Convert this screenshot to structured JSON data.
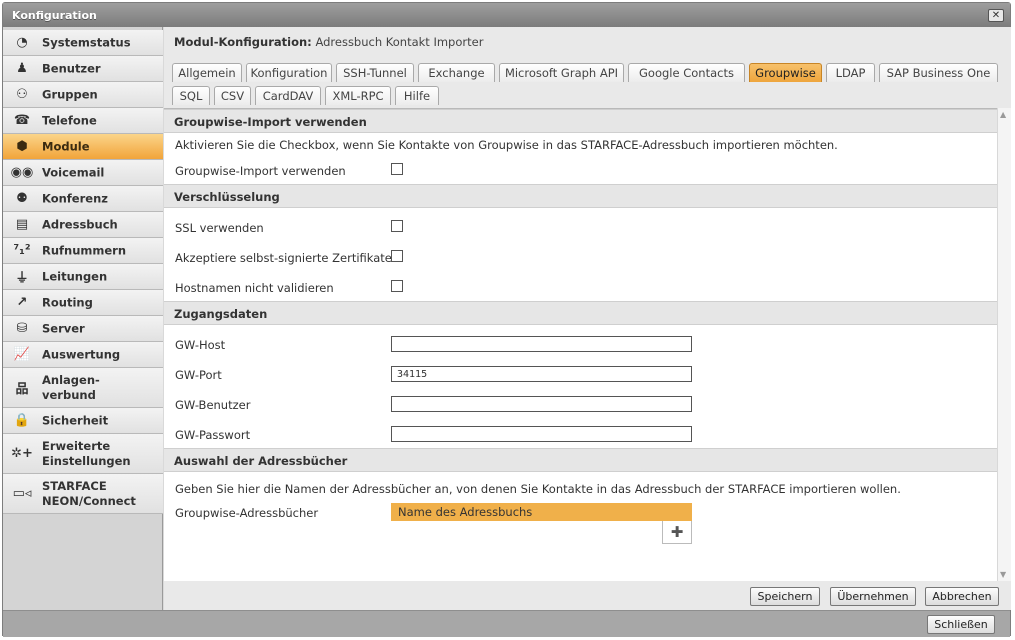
{
  "window": {
    "title": "Konfiguration",
    "close_symbol": "✕"
  },
  "sidebar": {
    "items": [
      {
        "label": "Systemstatus",
        "icon": "pie-chart-icon",
        "glyph": "◔"
      },
      {
        "label": "Benutzer",
        "icon": "user-icon",
        "glyph": "♟"
      },
      {
        "label": "Gruppen",
        "icon": "group-icon",
        "glyph": "⚇"
      },
      {
        "label": "Telefone",
        "icon": "telephone-icon",
        "glyph": "☎"
      },
      {
        "label": "Module",
        "icon": "cube-icon",
        "glyph": "⬢"
      },
      {
        "label": "Voicemail",
        "icon": "voicemail-icon",
        "glyph": "◉◉"
      },
      {
        "label": "Konferenz",
        "icon": "conference-icon",
        "glyph": "⚉"
      },
      {
        "label": "Adressbuch",
        "icon": "address-book-icon",
        "glyph": "▤"
      },
      {
        "label": "Rufnummern",
        "icon": "numbers-icon",
        "glyph": "⁷₁²"
      },
      {
        "label": "Leitungen",
        "icon": "lines-icon",
        "glyph": "⏚"
      },
      {
        "label": "Routing",
        "icon": "routing-icon",
        "glyph": "↗"
      },
      {
        "label": "Server",
        "icon": "server-icon",
        "glyph": "⛁"
      },
      {
        "label": "Auswertung",
        "icon": "line-chart-icon",
        "glyph": "📈"
      },
      {
        "label": "Anlagen-\nverbund",
        "icon": "network-icon",
        "glyph": "品"
      },
      {
        "label": "Sicherheit",
        "icon": "lock-icon",
        "glyph": "🔒"
      },
      {
        "label": "Erweiterte\nEinstellungen",
        "icon": "advanced-settings-icon",
        "glyph": "✲+"
      },
      {
        "label": "STARFACE\nNEON/Connect",
        "icon": "video-camera-icon",
        "glyph": "▭◃"
      }
    ],
    "active": "Module"
  },
  "module": {
    "heading_label": "Modul-Konfiguration:",
    "heading_value": "Adressbuch Kontakt Importer"
  },
  "tabs": {
    "row1": [
      "Allgemein",
      "Konfiguration",
      "SSH-Tunnel",
      "Exchange",
      "Microsoft Graph API",
      "Google Contacts",
      "Groupwise",
      "LDAP",
      "SAP Business One"
    ],
    "row2": [
      "SQL",
      "CSV",
      "CardDAV",
      "XML-RPC",
      "Hilfe"
    ],
    "active": "Groupwise"
  },
  "sections": {
    "import": {
      "title": "Groupwise-Import verwenden",
      "description": "Aktivieren Sie die Checkbox, wenn Sie Kontakte von Groupwise in das STARFACE-Adressbuch importieren möchten.",
      "checkbox_label": "Groupwise-Import verwenden",
      "checked": false
    },
    "encryption": {
      "title": "Verschlüsselung",
      "options": [
        {
          "label": "SSL verwenden",
          "checked": false
        },
        {
          "label": "Akzeptiere selbst-signierte Zertifikate",
          "checked": false
        },
        {
          "label": "Hostnamen nicht validieren",
          "checked": false
        }
      ]
    },
    "credentials": {
      "title": "Zugangsdaten",
      "fields": [
        {
          "label": "GW-Host",
          "value": ""
        },
        {
          "label": "GW-Port",
          "value": "34115"
        },
        {
          "label": "GW-Benutzer",
          "value": ""
        },
        {
          "label": "GW-Passwort",
          "value": ""
        }
      ]
    },
    "addressbooks": {
      "title": "Auswahl der Adressbücher",
      "description": "Geben Sie hier die Namen der Adressbücher an, von denen Sie Kontakte in das Adressbuch der STARFACE importieren wollen.",
      "label": "Groupwise-Adressbücher",
      "column_header": "Name des Adressbuchs",
      "add_symbol": "✚"
    }
  },
  "buttons": {
    "save": "Speichern",
    "apply": "Übernehmen",
    "cancel": "Abbrechen",
    "close": "Schließen"
  },
  "colors": {
    "accent": "#f0a93f",
    "active_tab": "#eea53c"
  }
}
